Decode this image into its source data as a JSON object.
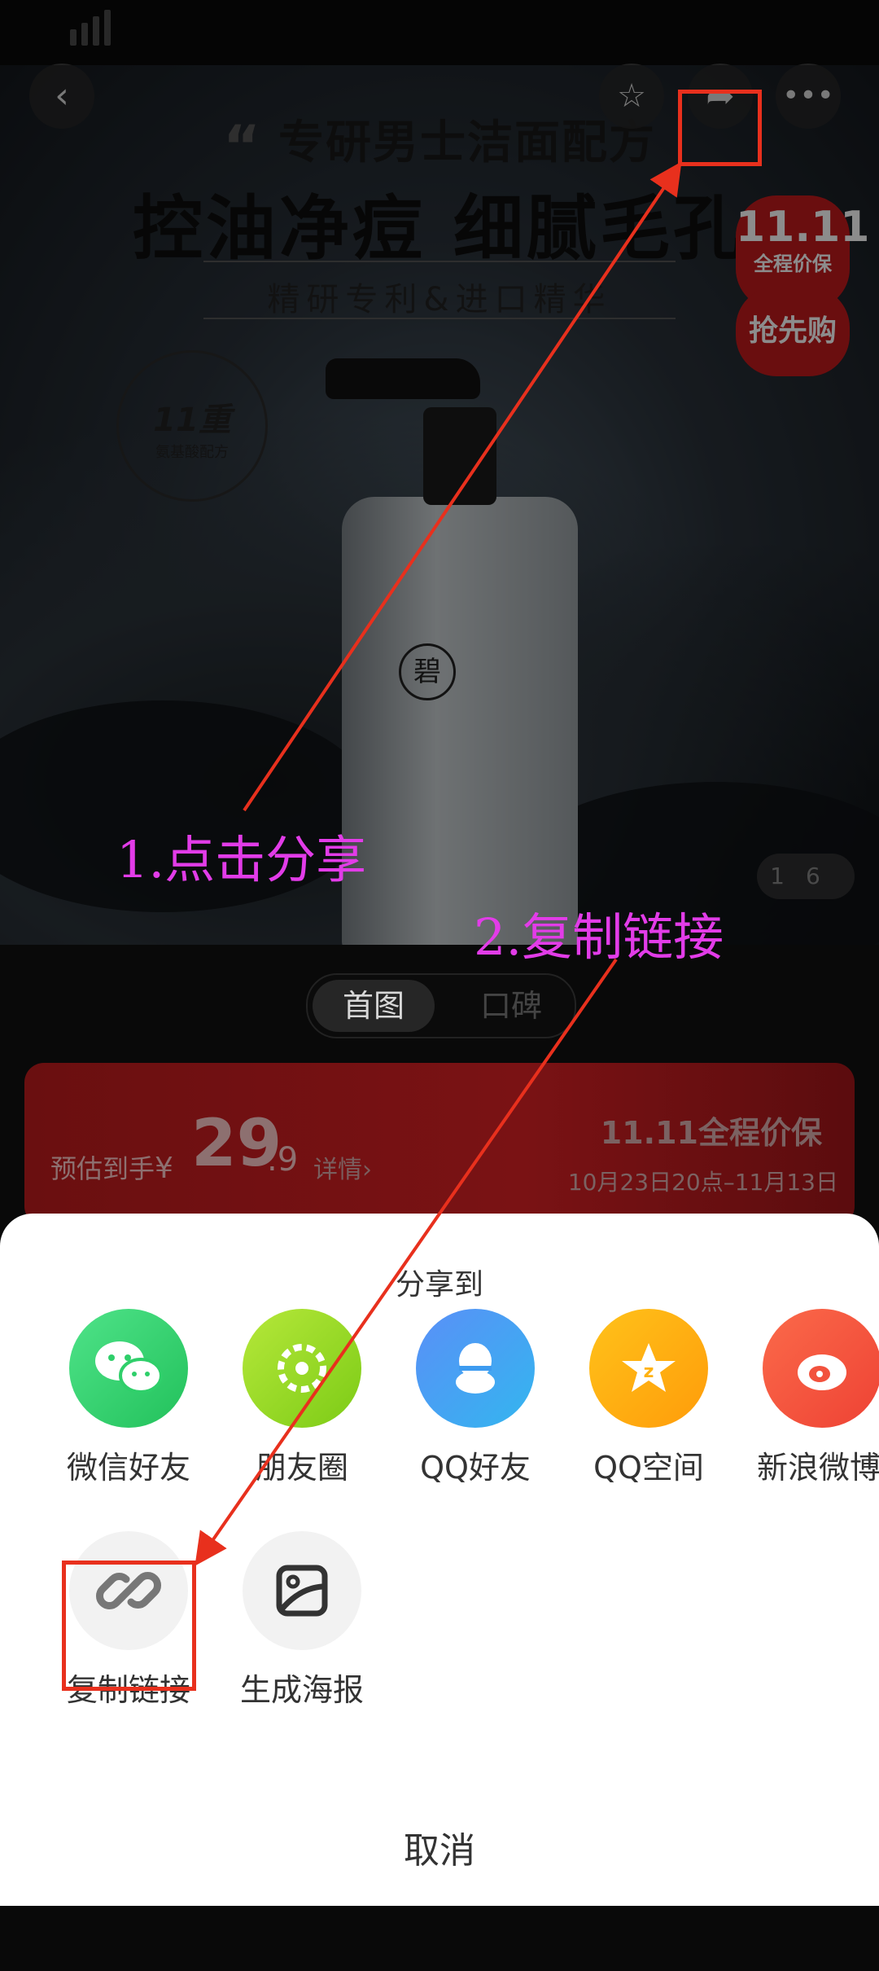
{
  "product_image": {
    "headline_line1": "专研男士洁面配方",
    "headline_line2": "控油净痘 细腻毛孔",
    "headline_line3": "精研专利&进口精华",
    "seal_number": "11重",
    "seal_text": "氨基酸配方",
    "bottle_logo": "碧",
    "badge_festival": "11.11",
    "badge_protect": "全程价保",
    "badge_buy": "抢先购",
    "pager_current": "1",
    "pager_total": "6"
  },
  "top_nav": {
    "back_icon": "chevron-left-icon",
    "favorite_icon": "star-icon",
    "share_icon": "share-arrow-icon",
    "more_icon": "more-dots-icon"
  },
  "segment": {
    "active": "首图",
    "inactive": "口碑"
  },
  "price_card": {
    "label": "预估到手",
    "currency": "¥",
    "price_int": "29",
    "price_dec": ".9",
    "detail": "详情›",
    "promo": "11.11全程价保",
    "promo_dates": "10月23日20点–11月13日"
  },
  "share_sheet": {
    "title": "分享到",
    "targets": [
      {
        "label": "微信好友",
        "color": "#2fcf6a",
        "icon": "wechat-icon"
      },
      {
        "label": "朋友圈",
        "color": "#8ed41f",
        "icon": "moments-icon"
      },
      {
        "label": "QQ好友",
        "color": "#3d9bf0",
        "icon": "qq-icon"
      },
      {
        "label": "QQ空间",
        "color": "#ffb20f",
        "icon": "qzone-icon"
      },
      {
        "label": "新浪微博",
        "color": "#f2523d",
        "icon": "weibo-icon"
      }
    ],
    "actions": [
      {
        "label": "复制链接",
        "icon": "link-icon"
      },
      {
        "label": "生成海报",
        "icon": "poster-icon"
      }
    ],
    "cancel": "取消"
  },
  "annotations": {
    "step1": "1.点击分享",
    "step2": "2.复制链接",
    "highlight_color": "#e8301d",
    "text_color": "#e23ce8"
  }
}
